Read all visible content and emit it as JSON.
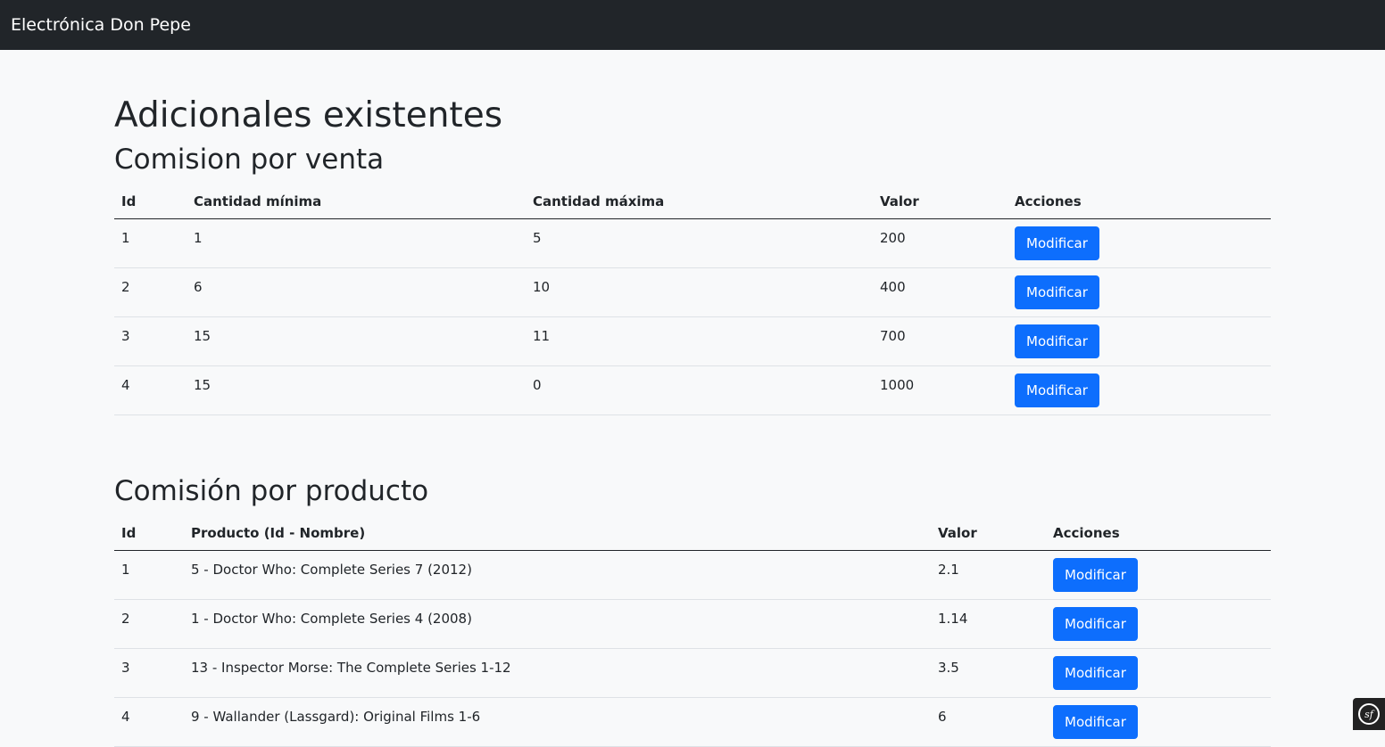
{
  "navbar": {
    "brand": "Electrónica Don Pepe"
  },
  "page": {
    "title": "Adicionales existentes"
  },
  "sales_commission": {
    "title": "Comision por venta",
    "headers": [
      "Id",
      "Cantidad mínima",
      "Cantidad máxima",
      "Valor",
      "Acciones"
    ],
    "rows": [
      {
        "id": "1",
        "min": "1",
        "max": "5",
        "value": "200",
        "action": "Modificar"
      },
      {
        "id": "2",
        "min": "6",
        "max": "10",
        "value": "400",
        "action": "Modificar"
      },
      {
        "id": "3",
        "min": "15",
        "max": "11",
        "value": "700",
        "action": "Modificar"
      },
      {
        "id": "4",
        "min": "15",
        "max": "0",
        "value": "1000",
        "action": "Modificar"
      }
    ]
  },
  "product_commission": {
    "title": "Comisión por producto",
    "headers": [
      "Id",
      "Producto (Id - Nombre)",
      "Valor",
      "Acciones"
    ],
    "rows": [
      {
        "id": "1",
        "product": "5 - Doctor Who: Complete Series 7 (2012)",
        "value": "2.1",
        "action": "Modificar"
      },
      {
        "id": "2",
        "product": "1 - Doctor Who: Complete Series 4 (2008)",
        "value": "1.14",
        "action": "Modificar"
      },
      {
        "id": "3",
        "product": "13 - Inspector Morse: The Complete Series 1-12",
        "value": "3.5",
        "action": "Modificar"
      },
      {
        "id": "4",
        "product": "9 - Wallander (Lassgard): Original Films 1-6",
        "value": "6",
        "action": "Modificar"
      }
    ]
  },
  "debug_toolbar": {
    "icon": "symfony-icon",
    "label": "sf"
  }
}
